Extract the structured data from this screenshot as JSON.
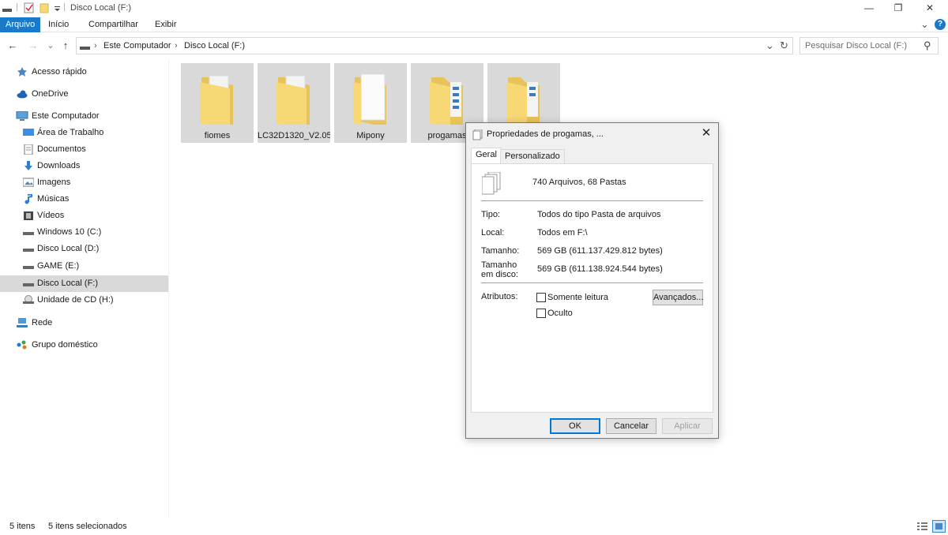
{
  "window": {
    "title": "Disco Local (F:)",
    "minimize_glyph": "—",
    "maximize_glyph": "❐",
    "close_glyph": "✕"
  },
  "ribbon": {
    "tabs": [
      "Arquivo",
      "Início",
      "Compartilhar",
      "Exibir"
    ],
    "expand_glyph": "⌄",
    "help_glyph": "?"
  },
  "nav": {
    "back_glyph": "←",
    "forward_glyph": "→",
    "recent_glyph": "⌄",
    "up_glyph": "↑"
  },
  "address": {
    "crumbs": [
      "Este Computador",
      "Disco Local (F:)"
    ],
    "separator": "›",
    "dropdown_glyph": "⌄",
    "refresh_glyph": "↻"
  },
  "search": {
    "placeholder": "Pesquisar Disco Local (F:)",
    "icon_glyph": "⚲"
  },
  "sidebar": {
    "items": [
      {
        "label": "Acesso rápido",
        "icon": "star-icon"
      },
      {
        "label": "OneDrive",
        "icon": "cloud-icon"
      },
      {
        "label": "Este Computador",
        "icon": "computer-icon"
      },
      {
        "label": "Área de Trabalho",
        "icon": "desktop-icon"
      },
      {
        "label": "Documentos",
        "icon": "documents-icon"
      },
      {
        "label": "Downloads",
        "icon": "download-icon"
      },
      {
        "label": "Imagens",
        "icon": "pictures-icon"
      },
      {
        "label": "Músicas",
        "icon": "music-icon"
      },
      {
        "label": "Vídeos",
        "icon": "video-icon"
      },
      {
        "label": "Windows 10 (C:)",
        "icon": "drive-icon"
      },
      {
        "label": "Disco Local (D:)",
        "icon": "drive-icon"
      },
      {
        "label": "GAME (E:)",
        "icon": "drive-icon"
      },
      {
        "label": "Disco Local (F:)",
        "icon": "drive-icon"
      },
      {
        "label": "Unidade de CD (H:)",
        "icon": "cd-drive-icon"
      },
      {
        "label": "Rede",
        "icon": "network-icon"
      },
      {
        "label": "Grupo doméstico",
        "icon": "homegroup-icon"
      }
    ]
  },
  "files": [
    {
      "name": "fiomes"
    },
    {
      "name": "LC32D1320_V2.05"
    },
    {
      "name": "Mipony"
    },
    {
      "name": "progamas"
    },
    {
      "name": ""
    }
  ],
  "status": {
    "count": "5 itens",
    "selected": "5 itens selecionados"
  },
  "dialog": {
    "title": "Propriedades de progamas, ...",
    "close_glyph": "✕",
    "tabs": [
      "Geral",
      "Personalizado"
    ],
    "summary": "740 Arquivos, 68 Pastas",
    "rows": [
      {
        "label": "Tipo:",
        "value": "Todos do tipo Pasta de arquivos"
      },
      {
        "label": "Local:",
        "value": "Todos em F:\\"
      },
      {
        "label": "Tamanho:",
        "value": "569 GB (611.137.429.812 bytes)"
      },
      {
        "label_line1": "Tamanho",
        "label_line2": "em disco:",
        "value": "569 GB (611.138.924.544 bytes)"
      }
    ],
    "attributes_label": "Atributos:",
    "readonly_label": "Somente leitura",
    "hidden_label": "Oculto",
    "advanced_button": "Avançados...",
    "ok": "OK",
    "cancel": "Cancelar",
    "apply": "Aplicar"
  },
  "colors": {
    "accent": "#1979ca",
    "selection": "#d9d9d9",
    "folder_yellow": "#f8d775"
  }
}
